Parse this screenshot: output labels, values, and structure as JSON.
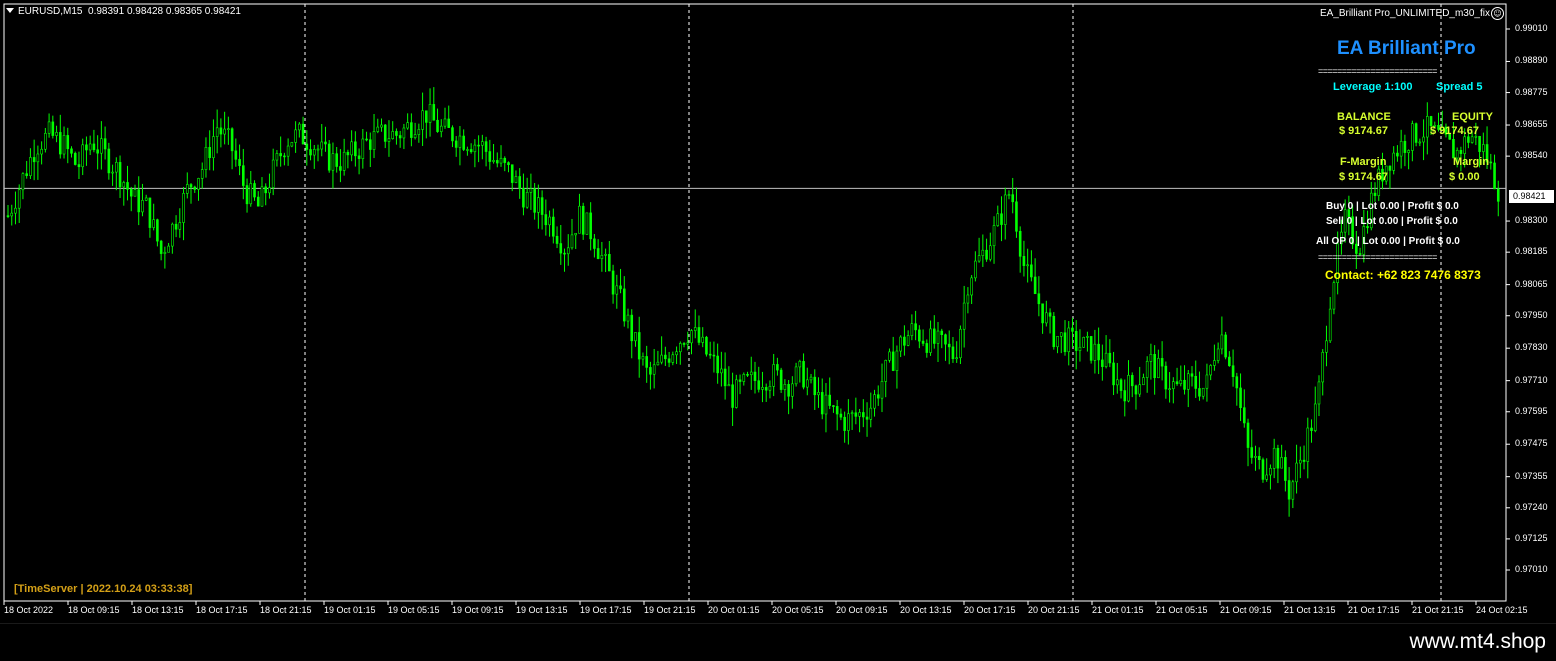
{
  "symbol": {
    "pair": "EURUSD,M15",
    "ohlc": "0.98391 0.98428 0.98365 0.98421"
  },
  "ea_title": "EA_Brilliant Pro_UNLIMITED_m30_fix",
  "panel": {
    "title": "EA Brilliant Pro",
    "separator": "=========================",
    "leverage_label": "Leverage  1:100",
    "spread_label": "Spread   5",
    "balance_label": "BALANCE",
    "balance_value": "$ 9174.67",
    "equity_label": "EQUITY",
    "equity_value": "$ 9174.67",
    "fmargin_label": "F-Margin",
    "fmargin_value": "$ 9174.67",
    "margin_label": "Margin",
    "margin_value": "$ 0.00",
    "buy_line": "Buy   0  |  Lot 0.00  |  Profit $ 0.0",
    "sell_line": "Sell   0  |  Lot 0.00  |  Profit $ 0.0",
    "allop_line": "All OP  0  |  Lot 0.00  |  Profit $ 0.0",
    "contact": "Contact: +62 823 7476 8373",
    "colors": {
      "title": "#1e90ff",
      "cyan": "#00ffff",
      "yellow": "#d7ff2f",
      "white": "#ffffff",
      "contact": "#ffff00"
    }
  },
  "time_server": "[TimeServer | 2022.10.24 03:33:38]",
  "price_axis": {
    "labels": [
      "0.99010",
      "0.98890",
      "0.98775",
      "0.98655",
      "0.98540",
      "0.98300",
      "0.98185",
      "0.98065",
      "0.97950",
      "0.97830",
      "0.97710",
      "0.97595",
      "0.97475",
      "0.97355",
      "0.97240",
      "0.97125",
      "0.97010"
    ],
    "current": "0.98421"
  },
  "time_axis": [
    "18 Oct 2022",
    "18 Oct 09:15",
    "18 Oct 13:15",
    "18 Oct 17:15",
    "18 Oct 21:15",
    "19 Oct 01:15",
    "19 Oct 05:15",
    "19 Oct 09:15",
    "19 Oct 13:15",
    "19 Oct 17:15",
    "19 Oct 21:15",
    "20 Oct 01:15",
    "20 Oct 05:15",
    "20 Oct 09:15",
    "20 Oct 13:15",
    "20 Oct 17:15",
    "20 Oct 21:15",
    "21 Oct 01:15",
    "21 Oct 05:15",
    "21 Oct 09:15",
    "21 Oct 13:15",
    "21 Oct 17:15",
    "21 Oct 21:15",
    "24 Oct 02:15"
  ],
  "candle_color": "#00ff00",
  "chart_data": {
    "type": "line",
    "series": [
      {
        "values": [
          0.9832,
          0.9845,
          0.9858,
          0.9862,
          0.9858,
          0.985,
          0.986,
          0.9854,
          0.9848,
          0.9838,
          0.9835,
          0.9818,
          0.983,
          0.9843,
          0.985,
          0.9865,
          0.9858,
          0.9842,
          0.9835,
          0.9848,
          0.986,
          0.9862,
          0.9858,
          0.9853,
          0.9852,
          0.9856,
          0.986,
          0.9862,
          0.9862,
          0.9866,
          0.987,
          0.9864,
          0.9862,
          0.986,
          0.9858,
          0.9852,
          0.9848,
          0.984,
          0.9835,
          0.983,
          0.982,
          0.9832,
          0.9825,
          0.9812,
          0.98,
          0.9785,
          0.9772,
          0.9778,
          0.9785,
          0.979,
          0.9782,
          0.9775,
          0.9765,
          0.977,
          0.9772,
          0.9773,
          0.977,
          0.9774,
          0.9765,
          0.976,
          0.9756,
          0.9758,
          0.9762,
          0.9774,
          0.9784,
          0.979,
          0.9786,
          0.9784,
          0.978,
          0.981,
          0.9818,
          0.9828,
          0.9842,
          0.9812,
          0.98,
          0.9788,
          0.9786,
          0.9784,
          0.9782,
          0.9776,
          0.9768,
          0.977,
          0.9778,
          0.9772,
          0.9768,
          0.977,
          0.9768,
          0.979,
          0.9775,
          0.9745,
          0.9738,
          0.9745,
          0.973,
          0.9745,
          0.9762,
          0.9805,
          0.983,
          0.982,
          0.984,
          0.9852,
          0.9858,
          0.9862,
          0.9864,
          0.986,
          0.9855,
          0.9862,
          0.9856,
          0.9842
        ]
      }
    ],
    "ylim": [
      0.9701,
      0.9901
    ]
  }
}
